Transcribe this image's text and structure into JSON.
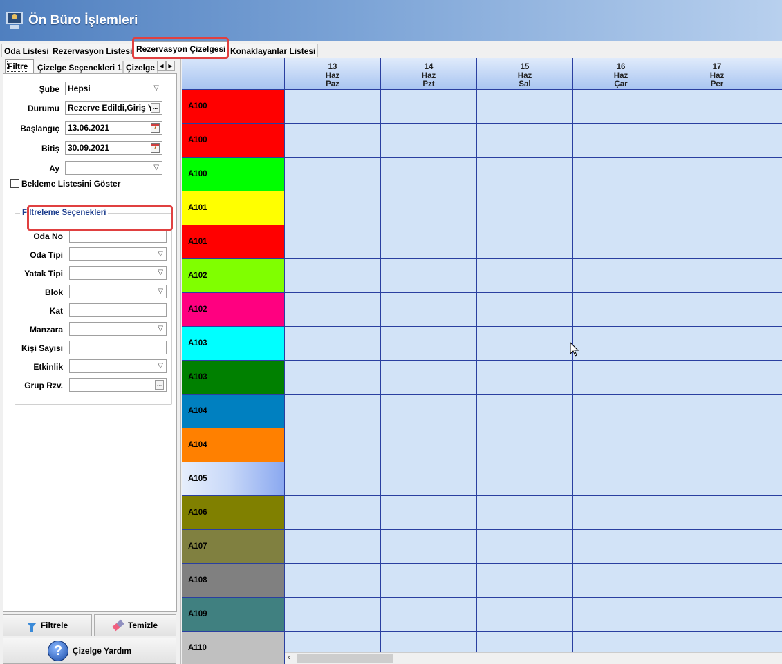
{
  "window": {
    "title": "Ön Büro İşlemleri"
  },
  "main_tabs": [
    {
      "label": "Oda Listesi"
    },
    {
      "label": "Rezervasyon Listesi"
    },
    {
      "label": "Rezervasyon Çizelgesi"
    },
    {
      "label": "Konaklayanlar Listesi"
    }
  ],
  "sub_tabs": [
    {
      "label": "Filtre"
    },
    {
      "label": "Çizelge Seçenekleri 1"
    },
    {
      "label": "Çizelge"
    }
  ],
  "filter": {
    "sube_label": "Şube",
    "sube_value": "Hepsi",
    "durum_label": "Durumu",
    "durum_value": "Rezerve Edildi,Giriş Y",
    "baslangic_label": "Başlangıç",
    "baslangic_value": "13.06.2021",
    "bitis_label": "Bitiş",
    "bitis_value": "30.09.2021",
    "ay_label": "Ay",
    "ay_value": "",
    "bekleme_label": "Bekleme Listesini Göster",
    "calendar_icon_text": "7",
    "ellipsis_text": "..."
  },
  "filter_options": {
    "title": "Filtreleme Seçenekleri",
    "oda_no": "Oda No",
    "oda_tipi": "Oda Tipi",
    "yatak_tipi": "Yatak Tipi",
    "blok": "Blok",
    "kat": "Kat",
    "manzara": "Manzara",
    "kisi_sayisi": "Kişi Sayısı",
    "etkinlik": "Etkinlik",
    "grup_rzv": "Grup Rzv."
  },
  "buttons": {
    "filtrele": "Filtrele",
    "temizle": "Temizle",
    "yardim": "Çizelge Yardım"
  },
  "schedule": {
    "columns": [
      {
        "day": "13",
        "month": "Haz",
        "weekday": "Paz"
      },
      {
        "day": "14",
        "month": "Haz",
        "weekday": "Pzt"
      },
      {
        "day": "15",
        "month": "Haz",
        "weekday": "Sal"
      },
      {
        "day": "16",
        "month": "Haz",
        "weekday": "Çar"
      },
      {
        "day": "17",
        "month": "Haz",
        "weekday": "Per"
      }
    ],
    "rooms": [
      {
        "label": "A100",
        "color": "#ff0000"
      },
      {
        "label": "A100",
        "color": "#ff0000"
      },
      {
        "label": "A100",
        "color": "#00ff00"
      },
      {
        "label": "A101",
        "color": "#ffff00"
      },
      {
        "label": "A101",
        "color": "#ff0000"
      },
      {
        "label": "A102",
        "color": "#80ff00"
      },
      {
        "label": "A102",
        "color": "#ff0080"
      },
      {
        "label": "A103",
        "color": "#00ffff"
      },
      {
        "label": "A103",
        "color": "#008000"
      },
      {
        "label": "A104",
        "color": "#0080c0"
      },
      {
        "label": "A104",
        "color": "#ff8000"
      },
      {
        "label": "A105",
        "color": "gradient"
      },
      {
        "label": "A106",
        "color": "#808000"
      },
      {
        "label": "A107",
        "color": "#808040"
      },
      {
        "label": "A108",
        "color": "#808080"
      },
      {
        "label": "A109",
        "color": "#408080"
      },
      {
        "label": "A110",
        "color": "#c0c0c0"
      }
    ],
    "scroll_left_arrow": "‹"
  }
}
